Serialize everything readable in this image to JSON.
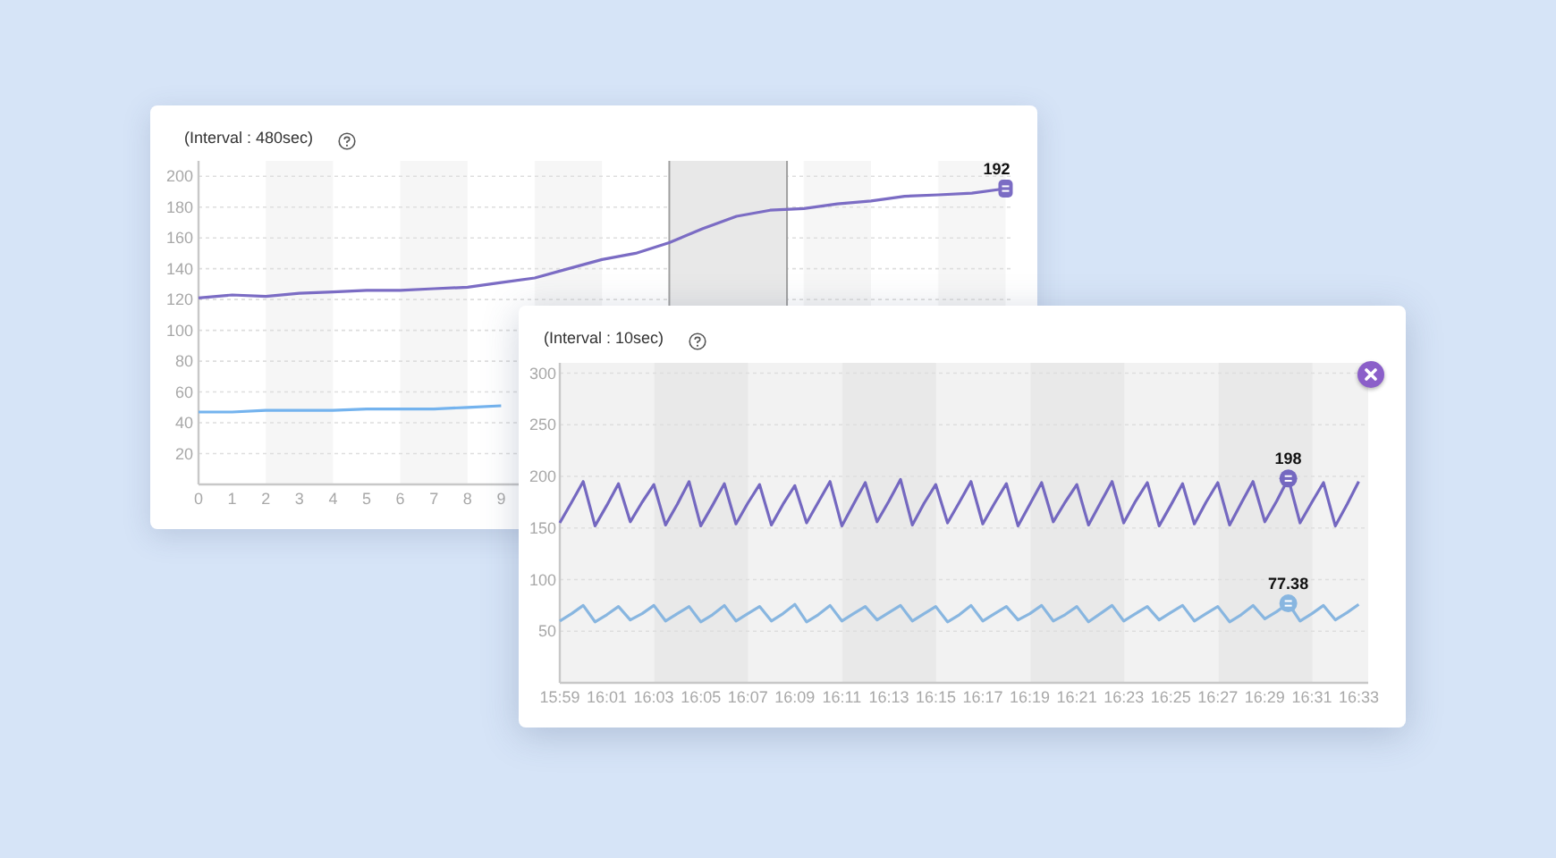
{
  "charts": [
    {
      "chart_data": {
        "type": "line",
        "title": "(Interval : 480sec)",
        "x": [
          0,
          1,
          2,
          3,
          4,
          5,
          6,
          7,
          8,
          9,
          10,
          11,
          12,
          13,
          14,
          15,
          16,
          17,
          18,
          19,
          20,
          21,
          22,
          23,
          24
        ],
        "xlim": [
          0,
          24.2
        ],
        "ylim": [
          0,
          210
        ],
        "xticks": [
          0,
          1,
          2,
          3,
          4,
          5,
          6,
          7,
          8,
          9
        ],
        "yticks": [
          20,
          40,
          60,
          80,
          100,
          120,
          140,
          160,
          180,
          200
        ],
        "grid": true,
        "series": [
          {
            "color": "#7b6cc4",
            "values": [
              121,
              123,
              122,
              124,
              125,
              126,
              126,
              127,
              128,
              131,
              134,
              140,
              146,
              150,
              157,
              166,
              174,
              178,
              179,
              182,
              184,
              187,
              188,
              189,
              192
            ]
          },
          {
            "color": "#74b3ee",
            "values": [
              47,
              47,
              48,
              48,
              48,
              49,
              49,
              49,
              50,
              51,
              null,
              null,
              null,
              null,
              null,
              null,
              null,
              null,
              null,
              null,
              null,
              null,
              null,
              null,
              null
            ]
          }
        ],
        "bands": [
          {
            "axis": "x",
            "from": 14,
            "to": 17.5
          }
        ],
        "ref_lines": [
          {
            "axis": "x",
            "value": 14
          },
          {
            "axis": "x",
            "value": 17.5
          }
        ],
        "annotations": [
          {
            "x": 24,
            "y": 192,
            "text": "192"
          }
        ]
      }
    },
    {
      "closable": true,
      "chart_data": {
        "type": "line",
        "title": "(Interval : 10sec)",
        "ylim": [
          0,
          310
        ],
        "yticks": [
          50,
          100,
          150,
          200,
          250,
          300
        ],
        "grid": true,
        "categories": [
          "15:59",
          null,
          null,
          null,
          "16:01",
          null,
          null,
          null,
          "16:03",
          null,
          null,
          null,
          "16:05",
          null,
          null,
          null,
          "16:07",
          null,
          null,
          null,
          "16:09",
          null,
          null,
          null,
          "16:11",
          null,
          null,
          null,
          "16:13",
          null,
          null,
          null,
          "16:15",
          null,
          null,
          null,
          "16:17",
          null,
          null,
          null,
          "16:19",
          null,
          null,
          null,
          "16:21",
          null,
          null,
          null,
          "16:23",
          null,
          null,
          null,
          "16:25",
          null,
          null,
          null,
          "16:27",
          null,
          null,
          null,
          "16:29",
          null,
          null,
          null,
          "16:31",
          null,
          null,
          null,
          "16:33"
        ],
        "series": [
          {
            "color": "#7468c0",
            "values": [
              155,
              175,
              195,
              152,
              172,
              193,
              156,
              175,
              192,
              153,
              173,
              195,
              152,
              172,
              193,
              154,
              174,
              192,
              153,
              173,
              191,
              155,
              175,
              195,
              152,
              173,
              194,
              156,
              176,
              197,
              153,
              174,
              192,
              155,
              175,
              195,
              154,
              174,
              193,
              152,
              173,
              194,
              156,
              175,
              192,
              153,
              174,
              195,
              155,
              176,
              194,
              152,
              172,
              193,
              154,
              175,
              194,
              153,
              174,
              195,
              156,
              176,
              198,
              155,
              175,
              194,
              152,
              173,
              195
            ]
          },
          {
            "color": "#88b6e0",
            "values": [
              60,
              67,
              75,
              59,
              66,
              74,
              61,
              67,
              75,
              60,
              67,
              74,
              59,
              66,
              75,
              60,
              67,
              74,
              60,
              67,
              76,
              59,
              66,
              75,
              60,
              67,
              74,
              61,
              68,
              75,
              60,
              67,
              74,
              59,
              66,
              75,
              60,
              67,
              74,
              61,
              67,
              75,
              60,
              66,
              74,
              59,
              67,
              75,
              60,
              67,
              74,
              61,
              68,
              75,
              60,
              67,
              74,
              59,
              66,
              75,
              62,
              69,
              77,
              60,
              67,
              75,
              61,
              68,
              76
            ]
          }
        ],
        "annotations": [
          {
            "y": 198,
            "text": "198"
          },
          {
            "y": 77,
            "text": "77.38"
          }
        ]
      }
    }
  ]
}
